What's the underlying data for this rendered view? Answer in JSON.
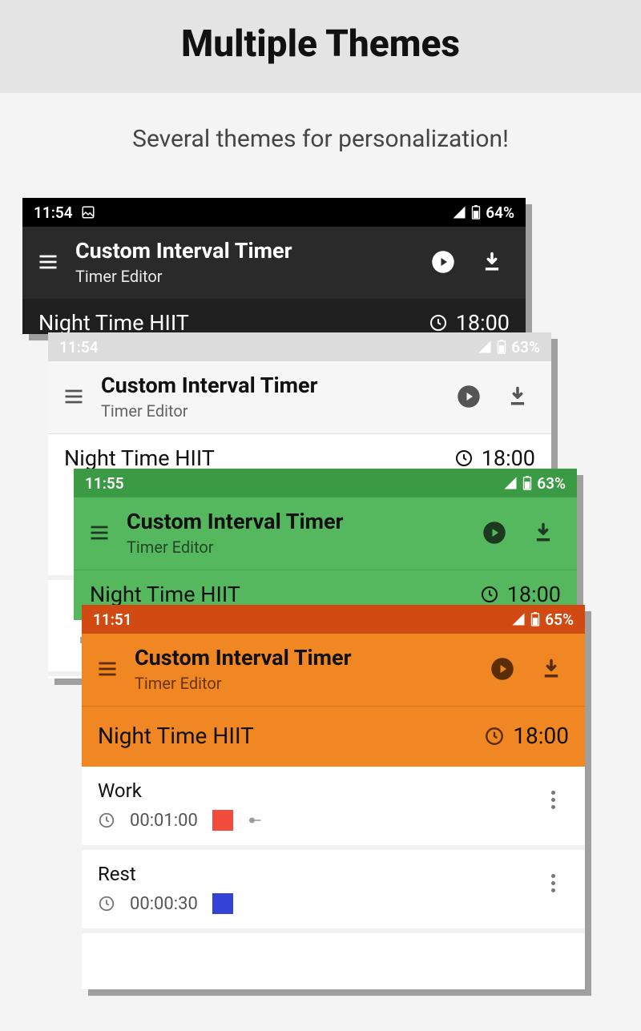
{
  "promo": {
    "title": "Multiple Themes",
    "subtitle": "Several themes for personalization!"
  },
  "app": {
    "title": "Custom Interval Timer",
    "subtitle": "Timer Editor"
  },
  "workout": {
    "name": "Night Time HIIT",
    "total": "18:00"
  },
  "cards": {
    "dark": {
      "time": "11:54",
      "battery": "64%"
    },
    "light": {
      "time": "11:54",
      "battery": "63%"
    },
    "green": {
      "time": "11:55",
      "battery": "63%"
    },
    "orange": {
      "time": "11:51",
      "battery": "65%"
    }
  },
  "intervals": [
    {
      "name": "Work",
      "duration": "00:01:00",
      "color": "#f24a3d"
    },
    {
      "name": "Rest",
      "duration": "00:00:30",
      "color": "#3442d8"
    }
  ]
}
